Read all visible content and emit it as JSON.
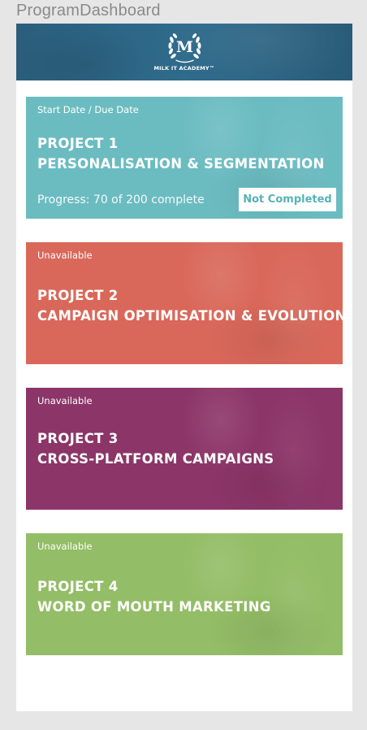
{
  "artboard": {
    "title": "ProgramDashboard"
  },
  "header": {
    "logo_monogram": "M",
    "logo_text": "MILK IT ACADEMY™",
    "logo_icon": "laurel-wreath-icon"
  },
  "projects": [
    {
      "status": "Start Date / Due Date",
      "title_line1": "PROJECT 1",
      "title_line2": "PERSONALISATION & SEGMENTATION",
      "progress_text": "Progress: 70 of 200 complete",
      "progress_completed": 70,
      "progress_total": 200,
      "button_label": "Not Completed",
      "color": "#6bbcc1"
    },
    {
      "status": "Unavailable",
      "title_line1": "PROJECT 2",
      "title_line2": "CAMPAIGN OPTIMISATION & EVOLUTION",
      "color": "#d9685a"
    },
    {
      "status": "Unavailable",
      "title_line1": "PROJECT 3",
      "title_line2": "CROSS-PLATFORM CAMPAIGNS",
      "color": "#8c3568"
    },
    {
      "status": "Unavailable",
      "title_line1": "PROJECT 4",
      "title_line2": "WORD OF MOUTH MARKETING",
      "color": "#93bd66"
    }
  ]
}
